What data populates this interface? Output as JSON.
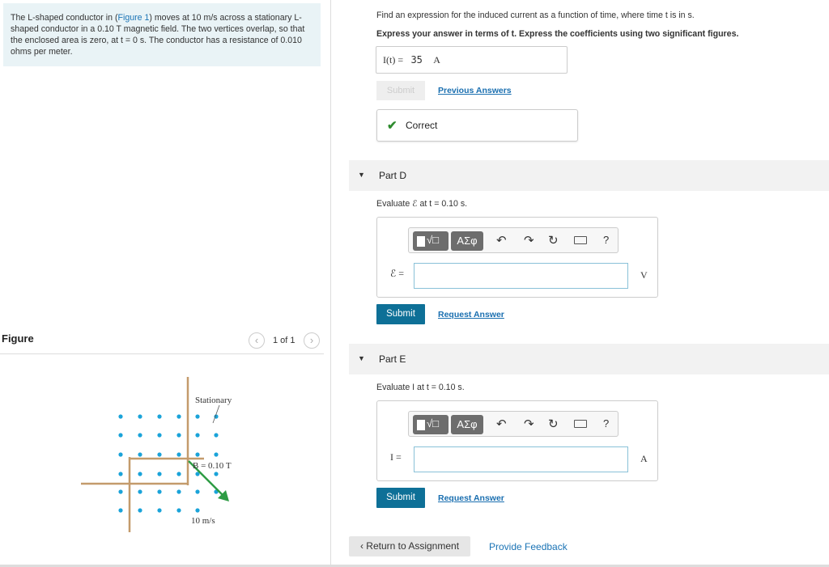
{
  "problem": {
    "text_before_link": "The L-shaped conductor in (",
    "link": "Figure 1",
    "text_after_link": ") moves at 10 m/s across a stationary L-shaped conductor in a 0.10 T magnetic field. The two vertices overlap, so that the enclosed area is zero, at t = 0 s. The conductor has a resistance of 0.010 ohms per meter."
  },
  "figure": {
    "title": "Figure",
    "prev_icon": "chevron-left-icon",
    "next_icon": "chevron-right-icon",
    "count": "1 of 1",
    "label_stationary": "Stationary",
    "label_field": "B = 0.10 T",
    "label_speed": "10 m/s",
    "colors": {
      "dots": "#1aa3d9",
      "conductor": "#c49b6c",
      "velocity": "#2e9c45"
    }
  },
  "question": {
    "text": "Find an expression for the induced current as a function of time, where time t is in s.",
    "instruction": "Express your answer in terms of t. Express the coefficients using two significant figures.",
    "answer_label": "I(t) =",
    "answer_value": "35",
    "answer_unit": "A",
    "submit_label": "Submit",
    "previous_answers_label": "Previous Answers",
    "correct_label": "Correct"
  },
  "partD": {
    "title": "Part D",
    "prompt": "Evaluate ℰ at t = 0.10 s.",
    "var_label": "ℰ =",
    "unit": "V",
    "submit_label": "Submit",
    "request_label": "Request Answer"
  },
  "partE": {
    "title": "Part E",
    "prompt": "Evaluate I at t = 0.10 s.",
    "var_label": "I =",
    "unit": "A",
    "submit_label": "Submit",
    "request_label": "Request Answer"
  },
  "toolbar": {
    "greek_label": "ΑΣφ",
    "help_label": "?"
  },
  "footer": {
    "return_label": "Return to Assignment",
    "feedback_label": "Provide Feedback"
  }
}
